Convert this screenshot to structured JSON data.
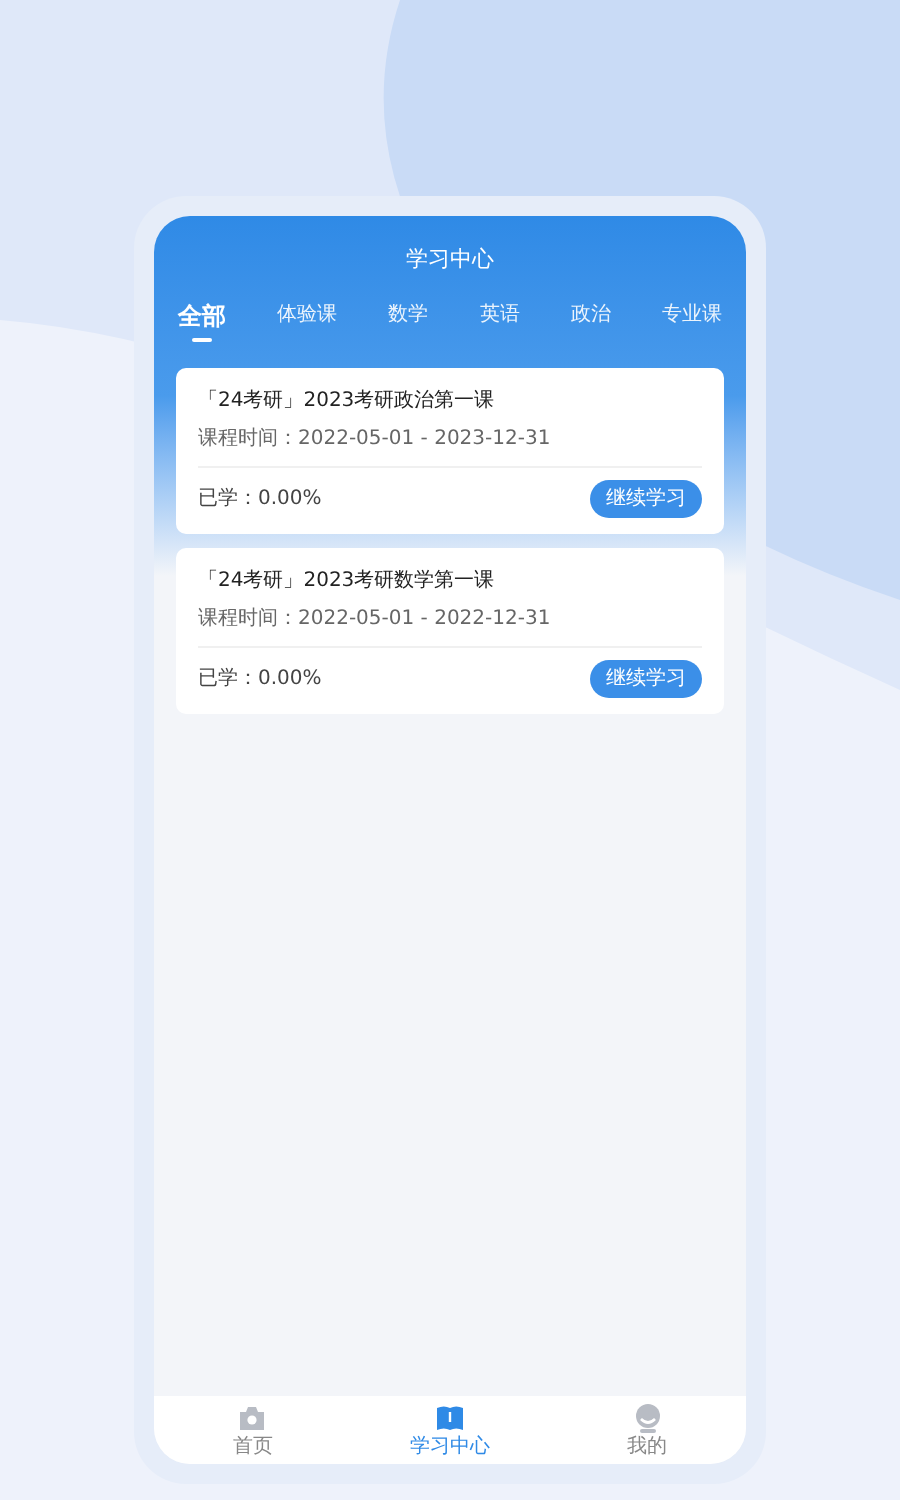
{
  "header": {
    "title": "学习中心"
  },
  "tabs": [
    {
      "label": "全部",
      "selected": true
    },
    {
      "label": "体验课",
      "selected": false
    },
    {
      "label": "数学",
      "selected": false
    },
    {
      "label": "英语",
      "selected": false
    },
    {
      "label": "政治",
      "selected": false
    },
    {
      "label": "专业课",
      "selected": false
    }
  ],
  "courses": [
    {
      "title": "「24考研」2023考研政治第一课",
      "period": "课程时间：2022-05-01 - 2023-12-31",
      "progress": "已学：0.00%",
      "button": "继续学习"
    },
    {
      "title": "「24考研」2023考研数学第一课",
      "period": "课程时间：2022-05-01 - 2022-12-31",
      "progress": "已学：0.00%",
      "button": "继续学习"
    }
  ],
  "bottom_nav": [
    {
      "label": "首页",
      "kind": "home",
      "selected": false
    },
    {
      "label": "学习中心",
      "kind": "study",
      "selected": true
    },
    {
      "label": "我的",
      "kind": "profile",
      "selected": false
    }
  ]
}
